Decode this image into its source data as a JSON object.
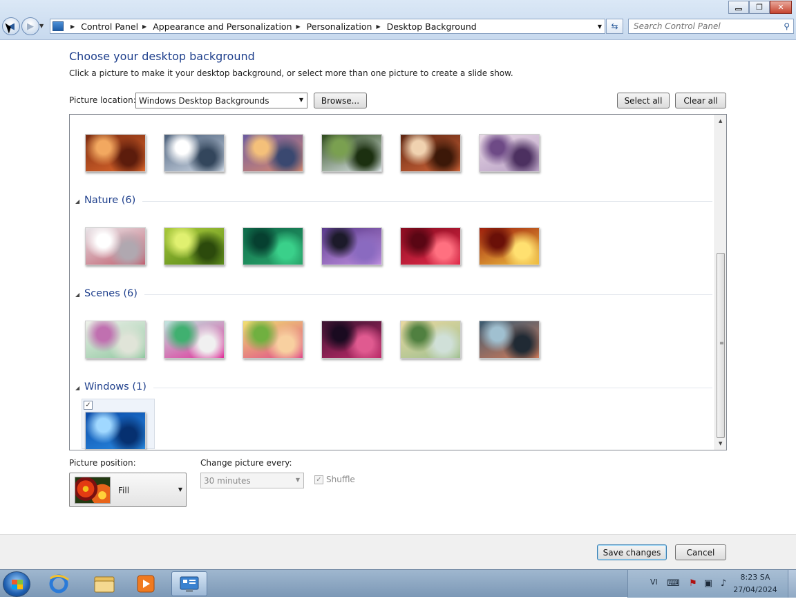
{
  "window": {
    "caption_buttons": {
      "minimize_icon": "minimize-icon",
      "restore_icon": "restore-icon",
      "close_icon": "close-icon"
    }
  },
  "nav": {
    "back_icon": "back-arrow-icon",
    "forward_icon": "forward-arrow-icon",
    "breadcrumb": [
      "Control Panel",
      "Appearance and Personalization",
      "Personalization",
      "Desktop Background"
    ],
    "search_placeholder": "Search Control Panel"
  },
  "main": {
    "heading": "Choose your desktop background",
    "subtext": "Click a picture to make it your desktop background, or select more than one picture to create a slide show.",
    "picture_location_label": "Picture location:",
    "picture_location_value": "Windows Desktop Backgrounds",
    "browse_label": "Browse...",
    "select_all_label": "Select all",
    "clear_all_label": "Clear all"
  },
  "gallery": {
    "top_row": [
      {
        "name": "canyon",
        "colors": [
          "#7a2a10",
          "#e06a2e",
          "#f2a860",
          "#5c1c0c"
        ]
      },
      {
        "name": "lake-ice",
        "colors": [
          "#4a5f7a",
          "#cfd9e6",
          "#ffffff",
          "#33465c"
        ]
      },
      {
        "name": "coast-sunset",
        "colors": [
          "#6a5aa0",
          "#d88a70",
          "#f4c07a",
          "#3a4870"
        ]
      },
      {
        "name": "waterfall",
        "colors": [
          "#2e4a1c",
          "#dfe8ec",
          "#7aa050",
          "#1c3010"
        ]
      },
      {
        "name": "arch-rock",
        "colors": [
          "#5c2410",
          "#d2663a",
          "#f0d2b0",
          "#3c1808"
        ]
      },
      {
        "name": "lavender",
        "colors": [
          "#e8d8e6",
          "#b8a0c4",
          "#6e4a86",
          "#4c3060"
        ]
      }
    ],
    "groups": [
      {
        "label": "Nature (6)",
        "items": [
          {
            "name": "dandelion",
            "colors": [
              "#e8e4e8",
              "#c06070",
              "#ffffff",
              "#b0a8b0"
            ]
          },
          {
            "name": "succulent",
            "colors": [
              "#a8c83a",
              "#5a8a1a",
              "#e0f070",
              "#2c4a0c"
            ]
          },
          {
            "name": "green-leaves",
            "colors": [
              "#0e6a4a",
              "#2aa46a",
              "#064030",
              "#3ad08a"
            ]
          },
          {
            "name": "thistle",
            "colors": [
              "#5a3a8c",
              "#c090e0",
              "#1c1a2a",
              "#8a6ac0"
            ]
          },
          {
            "name": "red-flower",
            "colors": [
              "#8a0c20",
              "#e02a4a",
              "#5a0614",
              "#ff7080"
            ]
          },
          {
            "name": "autumn-leaves",
            "colors": [
              "#a0200c",
              "#f0c040",
              "#6a1008",
              "#ffe070"
            ]
          }
        ]
      },
      {
        "label": "Scenes (6)",
        "items": [
          {
            "name": "abstract-light",
            "colors": [
              "#eef0ea",
              "#90c8a0",
              "#c070b0",
              "#e0e4d8"
            ]
          },
          {
            "name": "abstract-pink",
            "colors": [
              "#c0e8e0",
              "#e0309a",
              "#40b070",
              "#f0f0f0"
            ]
          },
          {
            "name": "abstract-flowers",
            "colors": [
              "#f0e070",
              "#e04a8a",
              "#70b040",
              "#f8d0a0"
            ]
          },
          {
            "name": "abstract-dark",
            "colors": [
              "#3a1430",
              "#c02a6a",
              "#1a0a20",
              "#e05a90"
            ]
          },
          {
            "name": "abstract-field",
            "colors": [
              "#e8d8a0",
              "#a0c090",
              "#508040",
              "#d0e0d8"
            ]
          },
          {
            "name": "abstract-shapes",
            "colors": [
              "#3a5a70",
              "#d07a5a",
              "#a0c0d0",
              "#202a34"
            ]
          }
        ]
      },
      {
        "label": "Windows (1)",
        "items": [
          {
            "name": "windows-7",
            "colors": [
              "#0a4aa8",
              "#2a8ae0",
              "#a0d8ff",
              "#063070"
            ],
            "selected": true
          }
        ]
      }
    ]
  },
  "options": {
    "picture_position_label": "Picture position:",
    "picture_position_value": "Fill",
    "change_every_label": "Change picture every:",
    "change_every_value": "30 minutes",
    "shuffle_label": "Shuffle"
  },
  "footer": {
    "save_label": "Save changes",
    "cancel_label": "Cancel"
  },
  "taskbar": {
    "apps": [
      "start-orb",
      "internet-explorer-icon",
      "file-explorer-icon",
      "media-player-icon",
      "control-panel-icon"
    ],
    "tray": {
      "language": "VI",
      "time": "8:23 SA",
      "date": "27/04/2024"
    }
  }
}
